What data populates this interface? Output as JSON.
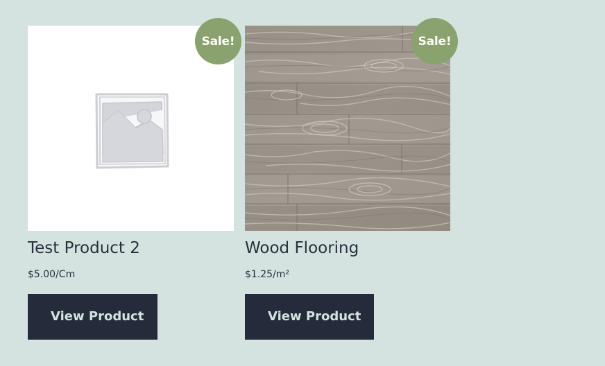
{
  "products": [
    {
      "title": "Test Product 2",
      "price": "$5.00/Cm",
      "badge": "Sale!",
      "button_label": "View Product",
      "image": "placeholder-image-icon"
    },
    {
      "title": "Wood Flooring",
      "price": "$1.25/m²",
      "badge": "Sale!",
      "button_label": "View Product",
      "image": "wood-flooring-photo"
    }
  ],
  "colors": {
    "page_background": "#d4e3df",
    "sale_badge": "#89a26e",
    "button_background": "#262b3b",
    "button_text": "#d4e3df",
    "text": "#28303d"
  }
}
